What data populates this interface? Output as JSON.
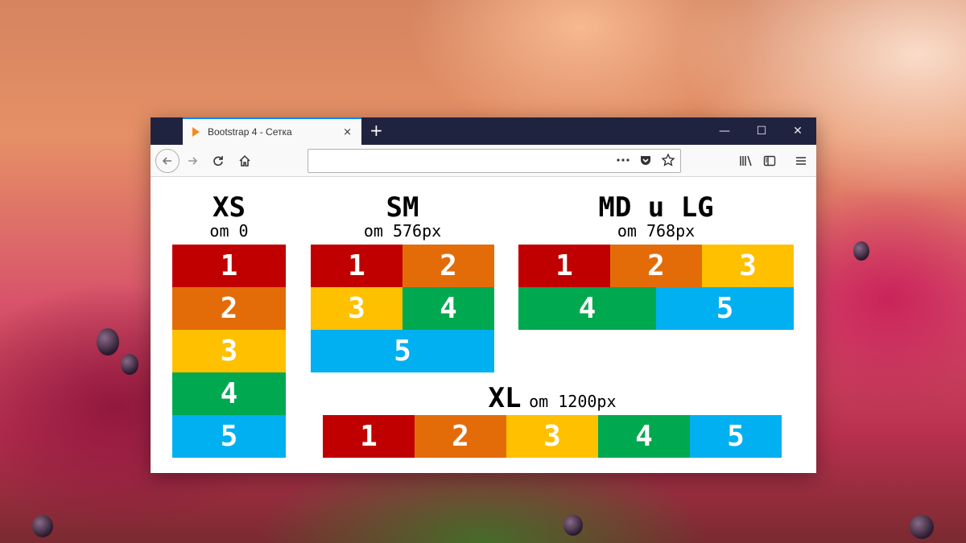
{
  "browser": {
    "tab_title": "Bootstrap 4 - Сетка",
    "tab_close": "×",
    "new_tab": "+",
    "url": "",
    "controls": {
      "minimize": "—",
      "maximize": "☐",
      "close": "✕"
    },
    "icons": {
      "back": "arrow-left-icon",
      "forward": "arrow-right-icon",
      "reload": "reload-icon",
      "home": "home-icon",
      "page_actions": "more-dots-icon",
      "pocket": "pocket-icon",
      "bookmark": "star-icon",
      "library": "library-icon",
      "sidebar": "sidebar-icon",
      "menu": "hamburger-menu-icon"
    }
  },
  "colors": {
    "c1": "#c00000",
    "c2": "#e36c09",
    "c3": "#ffc000",
    "c4": "#00a84f",
    "c5": "#00b0f0",
    "tabbar": "#202340",
    "accent": "#0a84ff"
  },
  "sections": {
    "xs": {
      "title": "XS",
      "subtitle": "om 0"
    },
    "sm": {
      "title": "SM",
      "subtitle": "om 576px"
    },
    "md": {
      "title": "MD u LG",
      "subtitle": "om 768px"
    },
    "xl": {
      "title": "XL",
      "subtitle": "om 1200px"
    }
  },
  "cells": [
    "1",
    "2",
    "3",
    "4",
    "5"
  ]
}
